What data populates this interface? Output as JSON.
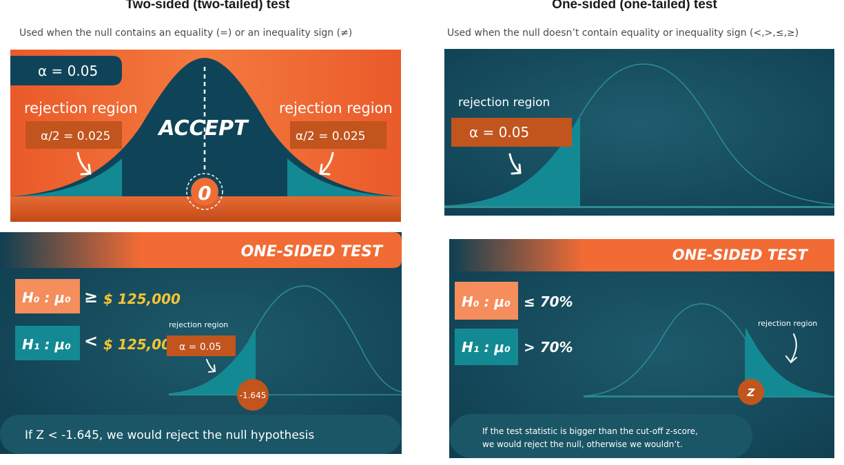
{
  "left": {
    "title": "Two-sided (two-tailed) test",
    "subtitle": "Used when the null contains an equality (=) or an inequality sign (≠)"
  },
  "right": {
    "title": "One-sided (one-tailed) test",
    "subtitle": "Used when the null doesn’t contain equality or inequality sign (<,>,≤,≥)"
  },
  "panel1": {
    "alpha": "α = 0.05",
    "rejection_left": "rejection region",
    "rejection_right": "rejection region",
    "alpha_half_left": "α/2 = 0.025",
    "alpha_half_right": "α/2 = 0.025",
    "accept": "ACCEPT",
    "zero": "0"
  },
  "panel2": {
    "rejection": "rejection region",
    "alpha": "α = 0.05"
  },
  "panel3": {
    "banner": "ONE-SIDED TEST",
    "h0_label": "H₀ : μ₀",
    "h0_sign": "≥",
    "h0_value": "$ 125,000",
    "h1_label": "H₁ : μ₀",
    "h1_sign": "<",
    "h1_value": "$ 125,000",
    "rejection": "rejection region",
    "alpha": "α = 0.05",
    "critical": "-1.645",
    "footer": "If Z < -1.645, we would reject the null hypothesis"
  },
  "panel4": {
    "banner": "ONE-SIDED TEST",
    "h0_label": "H₀ : μ₀",
    "h0_value": "≤ 70%",
    "h1_label": "H₁ : μ₀",
    "h1_value": "> 70%",
    "rejection": "rejection region",
    "z": "Z",
    "footer_line1": "If the test statistic is bigger than the cut-off z-score,",
    "footer_line2": "we would reject the null, otherwise we wouldn’t."
  },
  "colors": {
    "orange": "#f26b35",
    "dark_teal": "#0f4458",
    "teal_fill": "#138a93",
    "rust": "#c2541d",
    "yellow": "#f6c531",
    "salmon": "#f58d5c"
  }
}
